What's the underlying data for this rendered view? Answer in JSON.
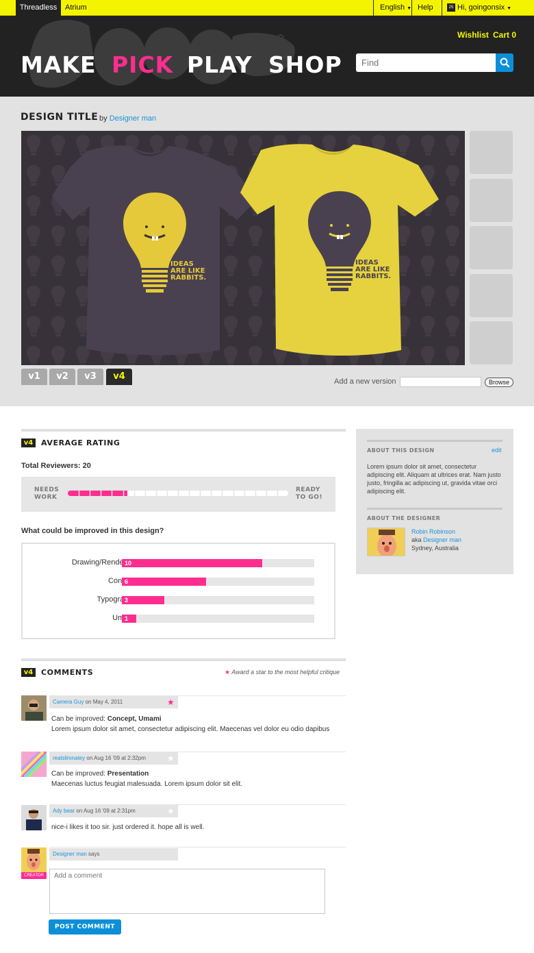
{
  "topbar": {
    "brand": "Threadless",
    "atrium": "Atrium",
    "language": "English",
    "help": "Help",
    "user_greeting": "Hi, goingonsix",
    "user_icon_text": "25"
  },
  "header": {
    "nav": [
      "MAKE",
      "PICK",
      "PLAY",
      "SHOP"
    ],
    "active_nav": "PICK",
    "wishlist": "Wishlist",
    "cart": "Cart 0",
    "search_placeholder": "Find"
  },
  "design": {
    "title": "DESIGN TITLE",
    "by": "by",
    "designer": "Designer man",
    "shirt_text": [
      "IDEAS",
      "ARE LIKE",
      "RABBITS."
    ],
    "versions": [
      "v1",
      "v2",
      "v3",
      "v4"
    ],
    "current_version": "v4",
    "add_version_label": "Add a new version",
    "browse_label": "Browse"
  },
  "rating": {
    "badge": "v4",
    "title": "AVERAGE RATING",
    "total_label": "Total Reviewers:",
    "total": "20",
    "left_label": [
      "NEEDS",
      "WORK"
    ],
    "right_label": [
      "READY",
      "TO GO!"
    ],
    "level": 0.27,
    "improve_question": "What could be improved in this design?"
  },
  "improvements": [
    {
      "label": "Drawing/Rendering",
      "value": 10
    },
    {
      "label": "Concept",
      "value": 6
    },
    {
      "label": "Typography",
      "value": 3
    },
    {
      "label": "Umami",
      "value": 1
    }
  ],
  "sidebar": {
    "about_design_title": "ABOUT THIS DESIGN",
    "edit": "edit",
    "about_design_text": "Lorem ipsum dolor sit amet, consectetur adipiscing elit. Aliquam at ultrices erat. Nam justo justo, fringilla ac adipiscing ut, gravida vitae orci adipiscing elit.",
    "about_designer_title": "ABOUT THE DESIGNER",
    "designer_name": "Robin Robinson",
    "aka_label": "aka",
    "aka_name": "Designer man",
    "location": "Sydney, Australia"
  },
  "comments_section": {
    "badge": "v4",
    "title": "COMMENTS",
    "star_hint": "Award a star to the most helpful critique"
  },
  "comments": [
    {
      "author": "Camera Guy",
      "date": "on May 4, 2011",
      "improve_label": "Can be improved:",
      "improve_items": "Concept, Umami",
      "text": "Lorem ipsum dolor sit amet, consectetur adipiscing elit. Maecenas vel dolor eu odio dapibus",
      "starred": true
    },
    {
      "author": "realslimnatey",
      "date": "on Aug 16 '09 at 2:32pm",
      "improve_label": "Can be improved:",
      "improve_items": "Presentation",
      "text": "Maecenas luctus feugiat malesuada. Lorem ipsum dolor sit elit.",
      "starred": false
    },
    {
      "author": "Ady bear",
      "date": "on Aug 16 '09 at 2:31pm",
      "text": "nice-i likes it too sir. just ordered it. hope all is well.",
      "starred": false
    }
  ],
  "new_comment": {
    "author": "Designer man",
    "says": "says",
    "creator_badge": "CREATOR",
    "placeholder": "Add a comment",
    "post_label": "POST COMMENT"
  },
  "colors": {
    "accent_yellow": "#f4f400",
    "accent_pink": "#ff2d8f",
    "link_blue": "#1a93d9",
    "dark": "#222222"
  }
}
